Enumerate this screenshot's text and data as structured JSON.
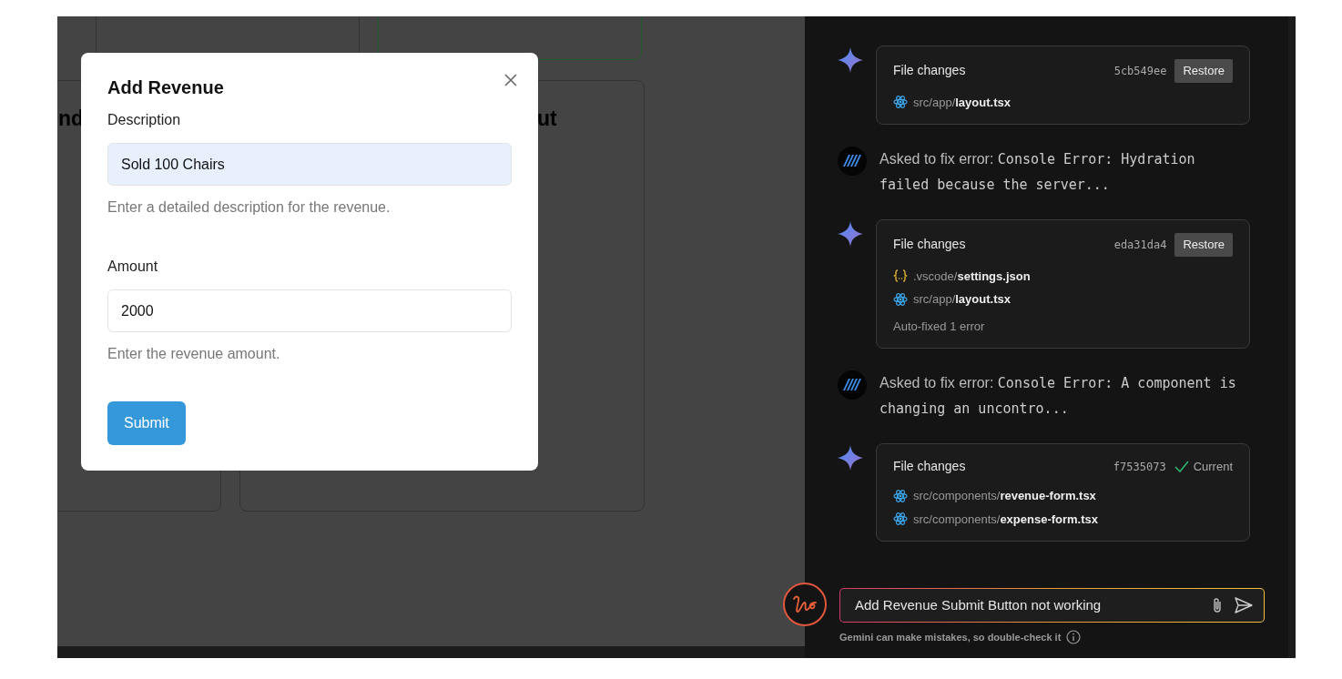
{
  "background": {
    "stat_cards": [
      {
        "accent": false
      },
      {
        "accent": true
      }
    ],
    "panels": [
      {
        "title": "nd"
      },
      {
        "title": "ut"
      }
    ]
  },
  "modal": {
    "title": "Add Revenue",
    "fields": [
      {
        "label": "Description",
        "value": "Sold 100 Chairs",
        "help": "Enter a detailed description for the revenue.",
        "autofilled": true
      },
      {
        "label": "Amount",
        "value": "2000",
        "help": "Enter the revenue amount.",
        "autofilled": false
      }
    ],
    "submit": "Submit"
  },
  "chat": {
    "messages": [
      {
        "kind": "files",
        "title": "File changes",
        "hash": "5cb549ee",
        "status": {
          "kind": "restore",
          "label": "Restore"
        },
        "files": [
          {
            "kind": "react",
            "dir": "src/app/",
            "name": "layout.tsx"
          }
        ]
      },
      {
        "kind": "asked",
        "prefix": "Asked to fix error:",
        "code": "Console Error: Hydration failed because the server..."
      },
      {
        "kind": "files",
        "title": "File changes",
        "hash": "eda31da4",
        "status": {
          "kind": "restore",
          "label": "Restore"
        },
        "files": [
          {
            "kind": "json",
            "dir": ".vscode/",
            "name": "settings.json"
          },
          {
            "kind": "react",
            "dir": "src/app/",
            "name": "layout.tsx"
          }
        ],
        "note": "Auto-fixed 1 error"
      },
      {
        "kind": "asked",
        "prefix": "Asked to fix error:",
        "code": "Console Error: A component is changing an uncontro..."
      },
      {
        "kind": "files",
        "title": "File changes",
        "hash": "f7535073",
        "status": {
          "kind": "current",
          "label": "Current"
        },
        "files": [
          {
            "kind": "react",
            "dir": "src/components/",
            "name": "revenue-form.tsx"
          },
          {
            "kind": "react",
            "dir": "src/components/",
            "name": "expense-form.tsx"
          }
        ]
      }
    ],
    "input": {
      "value": "Add Revenue Submit Button not working"
    },
    "disclaimer": "Gemini can make mistakes, so double-check it"
  }
}
